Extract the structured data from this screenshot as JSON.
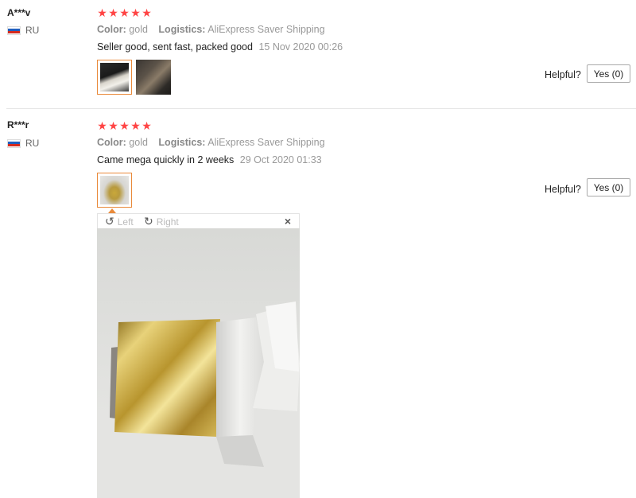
{
  "reviews": [
    {
      "user": "A***v",
      "country": "RU",
      "rating": 5,
      "color_label": "Color:",
      "color_value": "gold",
      "logistics_label": "Logistics:",
      "logistics_value": "AliExpress Saver Shipping",
      "text": "Seller good, sent fast, packed good",
      "date": "15 Nov 2020 00:26",
      "helpful_label": "Helpful?",
      "yes_label": "Yes (0)"
    },
    {
      "user": "R***r",
      "country": "RU",
      "rating": 5,
      "color_label": "Color:",
      "color_value": "gold",
      "logistics_label": "Logistics:",
      "logistics_value": "AliExpress Saver Shipping",
      "text": "Came mega quickly in 2 weeks",
      "date": "29 Oct 2020 01:33",
      "helpful_label": "Helpful?",
      "yes_label": "Yes (0)"
    }
  ],
  "viewer": {
    "rotate_left_label": "Left",
    "rotate_right_label": "Right",
    "close_symbol": "×"
  },
  "icons": {
    "star": "star-icon",
    "flag": "russia-flag-icon",
    "rotate_left": "rotate-left-icon",
    "rotate_right": "rotate-right-icon",
    "close": "close-icon"
  },
  "colors": {
    "star": "#ff4747",
    "active_border": "#e98a3a"
  }
}
